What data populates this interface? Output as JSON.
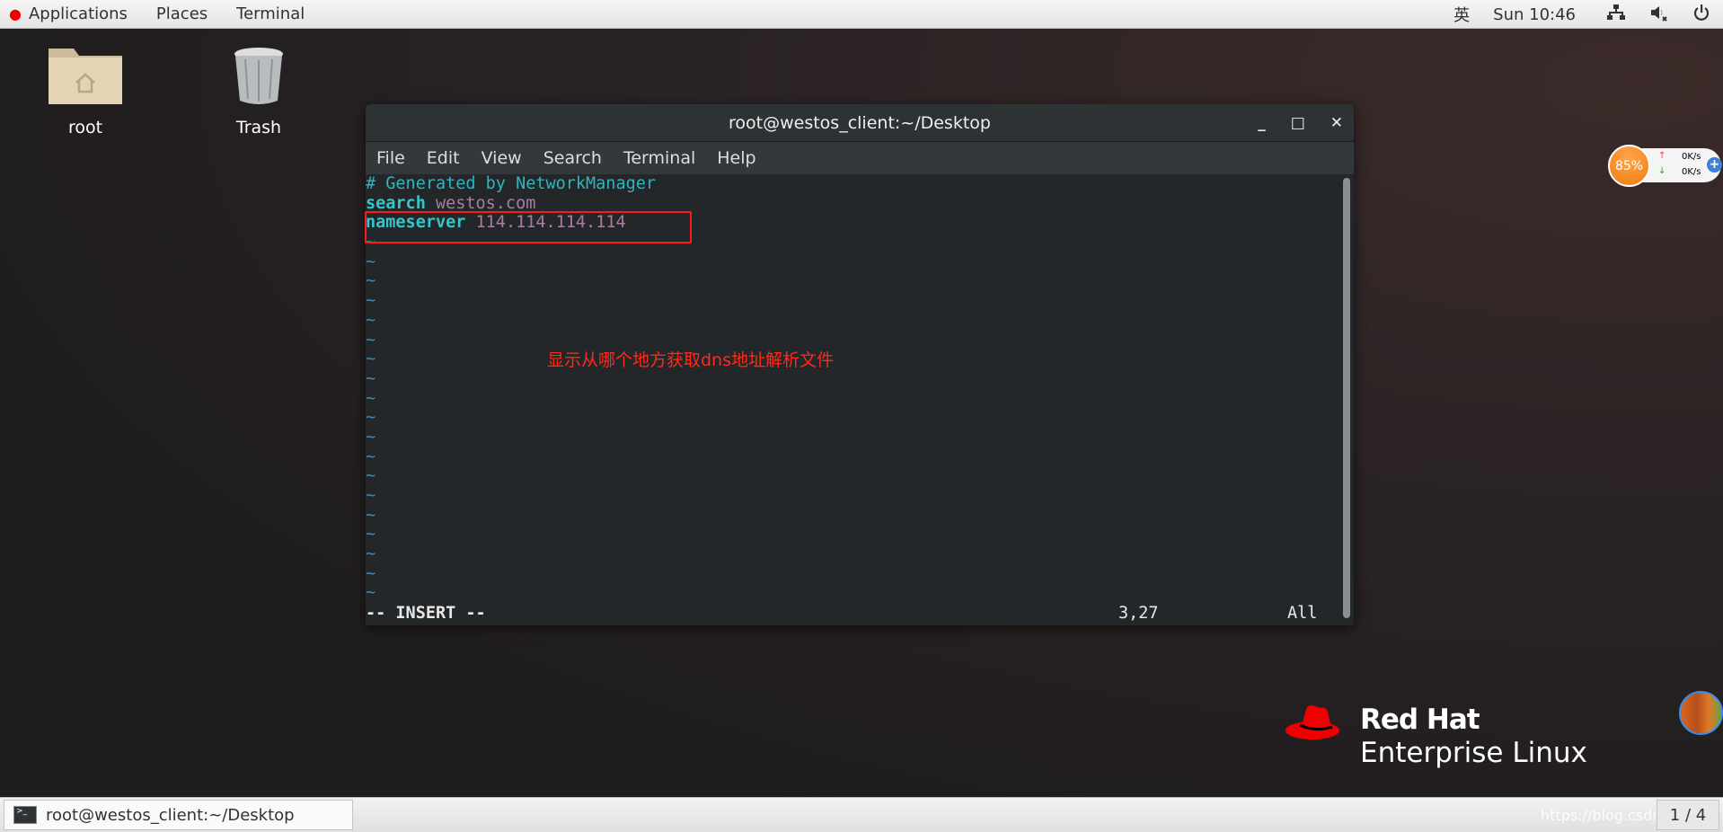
{
  "topbar": {
    "applications": "Applications",
    "places": "Places",
    "terminal": "Terminal",
    "input_method": "英",
    "clock": "Sun 10:46"
  },
  "desktop": {
    "icons": [
      {
        "label": "root"
      },
      {
        "label": "Trash"
      }
    ]
  },
  "terminal": {
    "title": "root@westos_client:~/Desktop",
    "menu": [
      "File",
      "Edit",
      "View",
      "Search",
      "Terminal",
      "Help"
    ],
    "lines": [
      {
        "key": "# Generated by NetworkManager",
        "value": ""
      },
      {
        "key": "search",
        "value": "westos.com"
      },
      {
        "key": "nameserver",
        "value": "114.114.114.114"
      }
    ],
    "tilde": "~",
    "mode": "-- INSERT --",
    "position": "3,27",
    "scroll": "All"
  },
  "annotation": "显示从哪个地方获取dns地址解析文件",
  "net_widget": {
    "percent": "85%",
    "up": "0K/s",
    "down": "0K/s"
  },
  "logo": {
    "line1": "Red Hat",
    "line2": "Enterprise Linux"
  },
  "taskbar": {
    "window": "root@westos_client:~/Desktop",
    "workspace": "1 / 4",
    "watermark": "https://blog.csdn.net/"
  },
  "colors": {
    "accent": "#ee0000",
    "highlight_box": "#ff1a1a"
  }
}
